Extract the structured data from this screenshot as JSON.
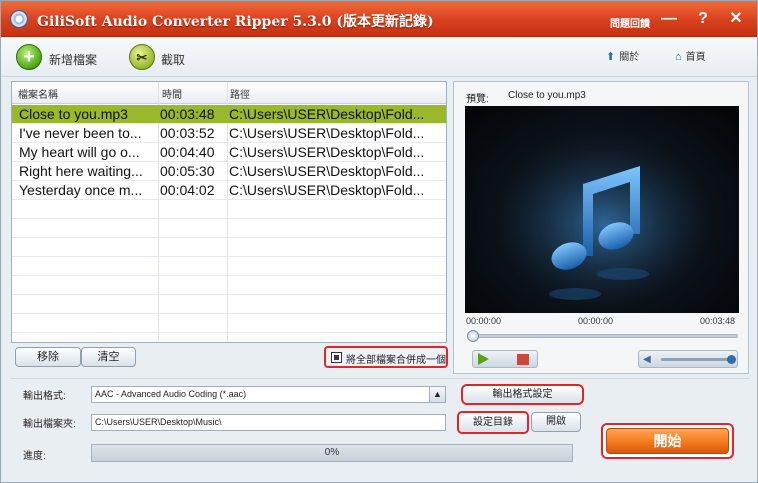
{
  "window": {
    "title": "GiliSoft Audio Converter Ripper 5.3.0 (版本更新記錄)",
    "title_link": "問題回饋",
    "controls": {
      "minimize": "—",
      "help": "?",
      "close": "✕"
    }
  },
  "toolbar": {
    "add_label": "新增檔案",
    "cut_label": "截取",
    "about_label": "關於",
    "home_label": "首頁"
  },
  "file_table": {
    "headers": [
      "檔案名稱",
      "時間",
      "路徑"
    ],
    "rows": [
      {
        "name": "Close to you.mp3",
        "time": "00:03:48",
        "path": "C:\\Users\\USER\\Desktop\\Fold..."
      },
      {
        "name": "I've never been to...",
        "time": "00:03:52",
        "path": "C:\\Users\\USER\\Desktop\\Fold..."
      },
      {
        "name": "My heart will go o...",
        "time": "00:04:40",
        "path": "C:\\Users\\USER\\Desktop\\Fold..."
      },
      {
        "name": "Right here waiting...",
        "time": "00:05:30",
        "path": "C:\\Users\\USER\\Desktop\\Fold..."
      },
      {
        "name": "Yesterday once m...",
        "time": "00:04:02",
        "path": "C:\\Users\\USER\\Desktop\\Fold..."
      }
    ],
    "remove_label": "移除",
    "clear_label": "清空",
    "merge_label": "將全部檔案合併成一個"
  },
  "preview": {
    "label": "預覽:",
    "file": "Close to you.mp3",
    "time_start": "00:00:00",
    "time_current": "00:00:00",
    "time_end": "00:03:48"
  },
  "settings": {
    "format_label": "輸出格式:",
    "format_value": "AAC - Advanced Audio Coding (*.aac)",
    "folder_label": "輸出檔案夾:",
    "folder_value": "C:\\Users\\USER\\Desktop\\Music\\",
    "progress_label": "進度:",
    "progress_text": "0%",
    "output_settings_label": "輸出格式設定",
    "set_dir_label": "設定目錄",
    "open_label": "開啟",
    "start_label": "開始"
  }
}
